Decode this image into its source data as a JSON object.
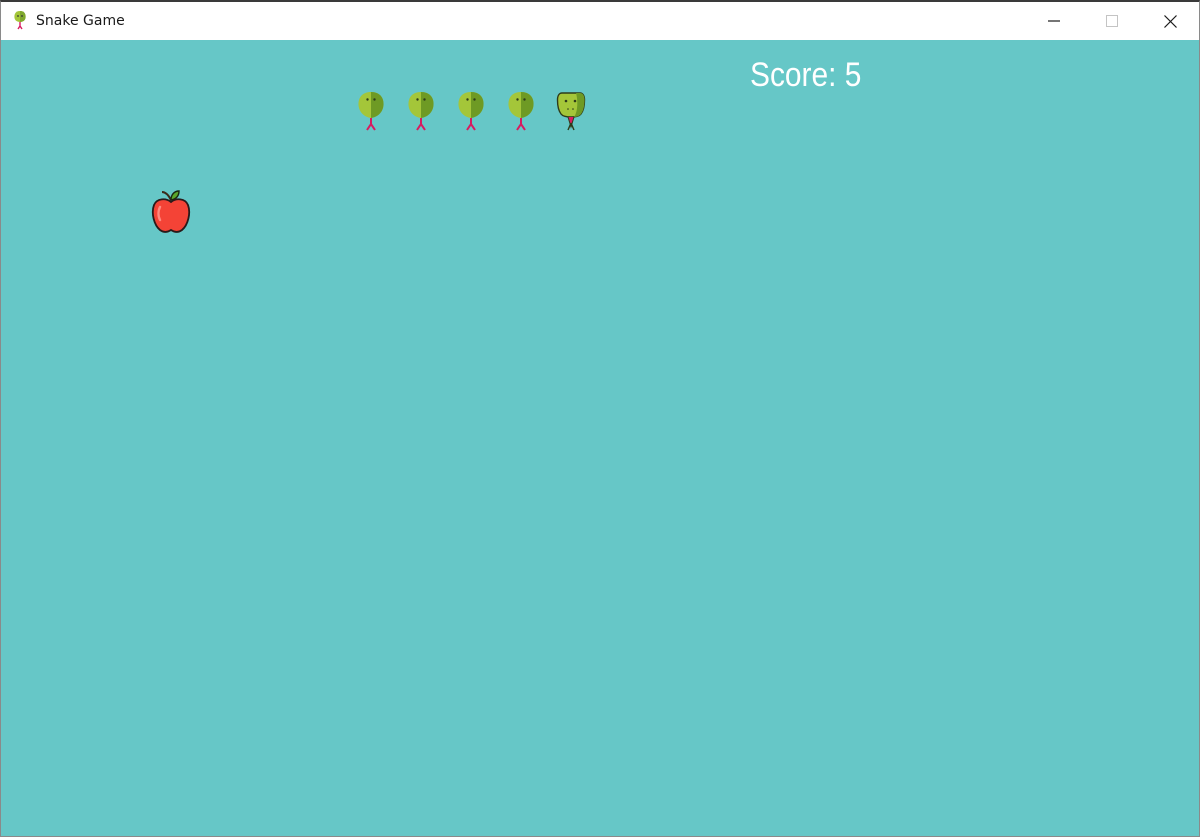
{
  "window": {
    "title": "Snake Game",
    "app_icon": "snake-icon",
    "controls": [
      "minimize-icon",
      "maximize-icon",
      "close-icon"
    ]
  },
  "game": {
    "score_text": "Score: 5",
    "background_color": "#66c7c7",
    "snake": {
      "head_direction": "right",
      "body_segments": 4,
      "head_icon": "snake-head-icon",
      "body_icon": "snake-body-segment-icon",
      "color_light": "#a4c639",
      "color_dark": "#6e9a24"
    },
    "food": {
      "icon": "apple-icon",
      "color": "#f44336"
    }
  }
}
